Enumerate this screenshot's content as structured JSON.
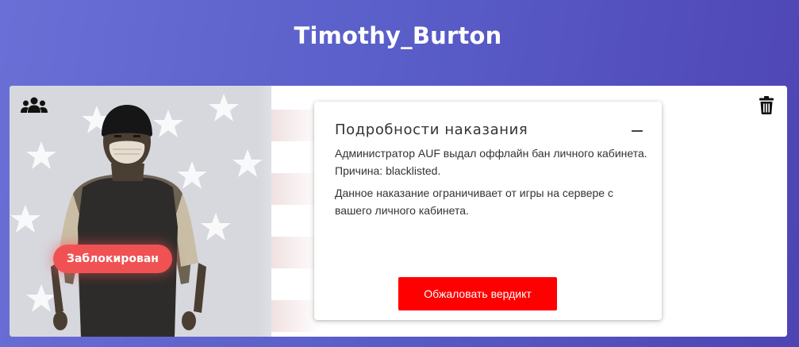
{
  "page": {
    "player_name": "Timothy_Burton"
  },
  "card": {
    "status_badge": "Заблокирован",
    "icons": {
      "group": "users-icon",
      "delete": "trash-icon",
      "collapse": "minus-icon"
    }
  },
  "details": {
    "title": "Подробности наказания",
    "paragraph1": "Администратор AUF выдал оффлайн бан личного кабинета. Причина: blacklisted.",
    "paragraph2": "Данное наказание ограничивает от игры на сервере с вашего личного кабинета.",
    "appeal_button": "Обжаловать вердикт"
  },
  "colors": {
    "background_start": "#6a6fd6",
    "background_end": "#4e44b4",
    "badge": "#f05254",
    "button": "#ff0000"
  }
}
